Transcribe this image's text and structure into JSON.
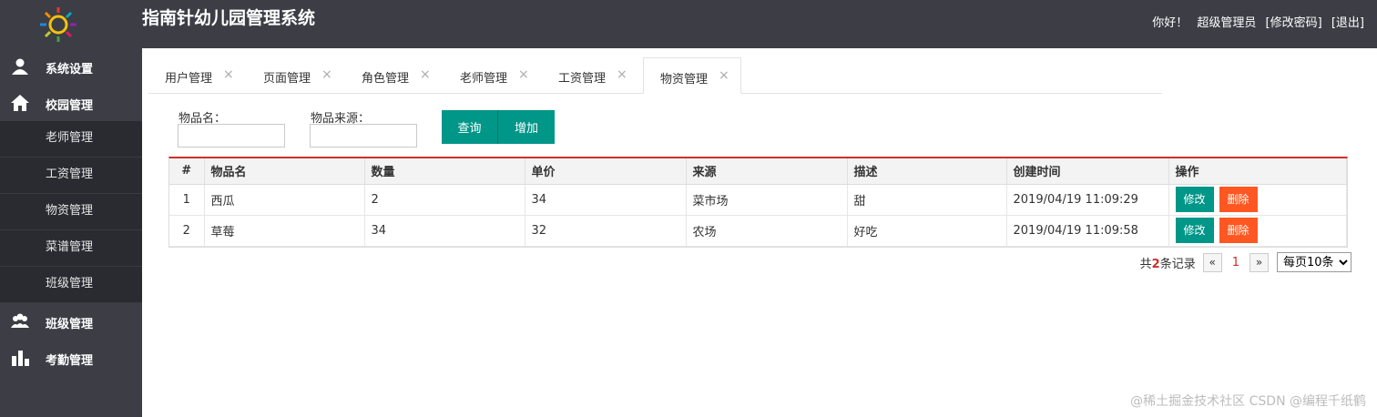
{
  "header": {
    "title": "指南针幼儿园管理系统",
    "greeting": "你好！",
    "username": "超级管理员",
    "change_password": "[修改密码]",
    "logout": "[退出]"
  },
  "sidebar": {
    "items": [
      {
        "label": "系统设置",
        "icon": "user-icon"
      },
      {
        "label": "校园管理",
        "icon": "home-icon"
      },
      {
        "label": "班级管理",
        "icon": "group-icon"
      },
      {
        "label": "考勤管理",
        "icon": "bar-chart-icon"
      }
    ],
    "sub_items": [
      "老师管理",
      "工资管理",
      "物资管理",
      "菜谱管理",
      "班级管理"
    ]
  },
  "tabs": [
    {
      "label": "用户管理",
      "close": "×"
    },
    {
      "label": "页面管理",
      "close": "×"
    },
    {
      "label": "角色管理",
      "close": "×"
    },
    {
      "label": "老师管理",
      "close": "×"
    },
    {
      "label": "工资管理",
      "close": "×"
    },
    {
      "label": "物资管理",
      "close": "×"
    }
  ],
  "active_tab": "物资管理",
  "search": {
    "name_label": "物品名：",
    "name_value": "",
    "source_label": "物品来源：",
    "source_value": "",
    "query_button": "查询",
    "add_button": "增加"
  },
  "table": {
    "columns": [
      "#",
      "物品名",
      "数量",
      "单价",
      "来源",
      "描述",
      "创建时间",
      "操作"
    ],
    "rows": [
      {
        "no": "1",
        "name": "西瓜",
        "qty": "2",
        "price": "34",
        "source": "菜市场",
        "desc": "甜",
        "created": "2019/04/19 11:09:29"
      },
      {
        "no": "2",
        "name": "草莓",
        "qty": "34",
        "price": "32",
        "source": "农场",
        "desc": "好吃",
        "created": "2019/04/19 11:09:58"
      }
    ],
    "edit_label": "修改",
    "delete_label": "删除"
  },
  "pager": {
    "total_prefix": "共",
    "total_count": "2",
    "total_suffix": "条记录",
    "prev": "«",
    "current": "1",
    "next": "»",
    "page_size": "每页10条"
  },
  "watermark": "@稀土掘金技术社区 CSDN @编程千纸鹤",
  "colors": {
    "sidebar": "#3c3d45",
    "primary": "#009688",
    "danger": "#ff5722",
    "accent": "#c9302c"
  }
}
